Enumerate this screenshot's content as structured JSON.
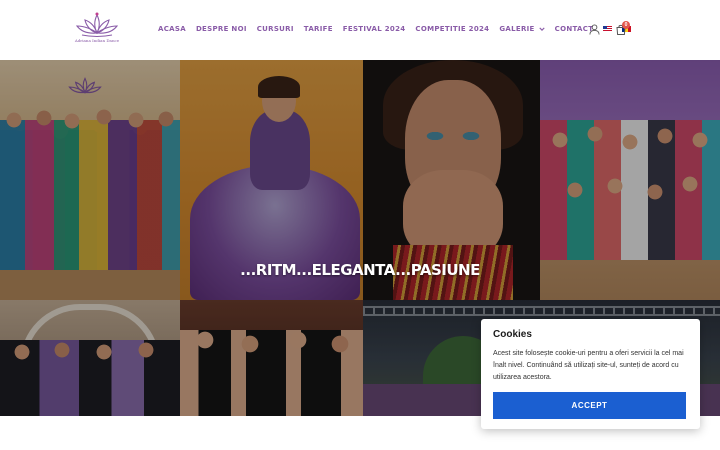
{
  "brand": {
    "logo_text": "Adriana Indian Dance",
    "accent": "#8a5ca8"
  },
  "nav": {
    "items": [
      {
        "label": "ACASA"
      },
      {
        "label": "DESPRE NOI"
      },
      {
        "label": "CURSURI"
      },
      {
        "label": "TARIFE"
      },
      {
        "label": "FESTIVAL 2024"
      },
      {
        "label": "COMPETITIE 2024"
      },
      {
        "label": "GALERIE"
      },
      {
        "label": "CONTACT"
      }
    ],
    "languages": [
      "English",
      "Română"
    ]
  },
  "header": {
    "cart_count": "0"
  },
  "hero": {
    "tagline": "...RITM...ELEGANTA...PASIUNE"
  },
  "cookie": {
    "title": "Cookies",
    "text": "Acest site folosește cookie-uri pentru a oferi servicii la cel mai înalt nivel. Continuând să utilizați site-ul, sunteți de acord cu utilizarea acestora.",
    "accept_label": "ACCEPT",
    "button_color": "#1b5fd1"
  }
}
